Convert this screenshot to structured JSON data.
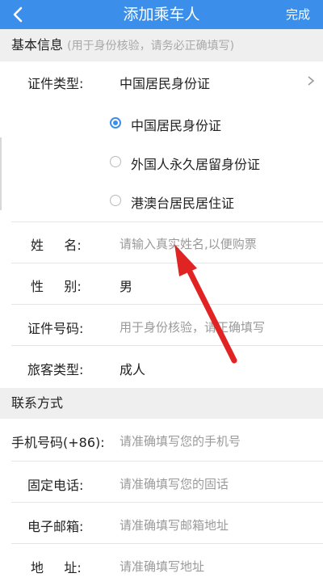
{
  "header": {
    "title": "添加乘车人",
    "done_label": "完成"
  },
  "sections": {
    "basic": {
      "title": "基本信息",
      "hint": "(用于身份核验，请务必正确填写)"
    },
    "contact": {
      "title": "联系方式"
    }
  },
  "fields": {
    "id_type": {
      "label": "证件类型:",
      "value": "中国居民身份证"
    },
    "id_options": [
      {
        "label": "中国居民身份证",
        "selected": true
      },
      {
        "label": "外国人永久居留身份证",
        "selected": false
      },
      {
        "label": "港澳台居民居住证",
        "selected": false
      }
    ],
    "name": {
      "label": "姓     名:",
      "placeholder": "请输入真实姓名,以便购票"
    },
    "gender": {
      "label": "性     别:",
      "value": "男"
    },
    "id_number": {
      "label": "证件号码:",
      "placeholder": "用于身份核验，请正确填写"
    },
    "passenger_type": {
      "label": "旅客类型:",
      "value": "成人"
    },
    "mobile": {
      "label": "手机号码(+86):",
      "placeholder": "请准确填写您的手机号"
    },
    "phone": {
      "label": "固定电话:",
      "placeholder": "请准确填写您的固话"
    },
    "email": {
      "label": "电子邮箱:",
      "placeholder": "请准确填写邮箱地址"
    },
    "address": {
      "label": "地     址:",
      "placeholder": "请准确填写地址"
    }
  },
  "colors": {
    "accent": "#3b8fea",
    "annotation_arrow": "#e02424",
    "section_bg": "#efefef"
  }
}
